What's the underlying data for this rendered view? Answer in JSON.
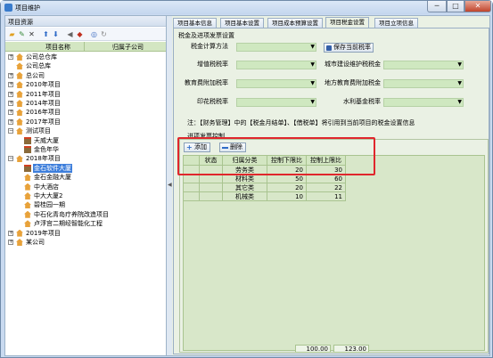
{
  "window": {
    "title": "项目维护",
    "min": "─",
    "max": "□",
    "close": "✕"
  },
  "left": {
    "title": "项目资源",
    "tree_header": {
      "col1": "项目名称",
      "col2": "归属子公司"
    },
    "nodes": [
      {
        "label": "公司总仓库",
        "expander": "+",
        "icon": "house"
      },
      {
        "label": "公司总库",
        "expander": "",
        "icon": "house"
      },
      {
        "label": "总公司",
        "expander": "+",
        "icon": "house"
      },
      {
        "label": "2010年项目",
        "expander": "+",
        "icon": "house"
      },
      {
        "label": "2011年项目",
        "expander": "+",
        "icon": "house"
      },
      {
        "label": "2014年项目",
        "expander": "+",
        "icon": "house"
      },
      {
        "label": "2016年项目",
        "expander": "+",
        "icon": "house"
      },
      {
        "label": "2017年项目",
        "expander": "+",
        "icon": "house"
      },
      {
        "label": "测试项目",
        "expander": "−",
        "icon": "house"
      },
      {
        "label": "天威大厦",
        "expander": "",
        "icon": "bldg"
      },
      {
        "label": "金色年华",
        "expander": "",
        "icon": "bldg"
      },
      {
        "label": "2018年项目",
        "expander": "−",
        "icon": "house"
      },
      {
        "label": "金石软件大厦",
        "expander": "",
        "icon": "bldg",
        "selected": true
      },
      {
        "label": "金石金融大厦",
        "expander": "",
        "icon": "house"
      },
      {
        "label": "中大酒店",
        "expander": "",
        "icon": "house"
      },
      {
        "label": "中大大厦2",
        "expander": "",
        "icon": "house"
      },
      {
        "label": "碧桂园一期",
        "expander": "",
        "icon": "house"
      },
      {
        "label": "中石化青岛疗养院改造项目",
        "expander": "",
        "icon": "house"
      },
      {
        "label": "卢浮宫二期经智能化工程",
        "expander": "",
        "icon": "house"
      },
      {
        "label": "2019年项目",
        "expander": "+",
        "icon": "house"
      },
      {
        "label": "某公司",
        "expander": "+",
        "icon": "house"
      }
    ]
  },
  "tabs": [
    "项目基本信息",
    "项目基本设置",
    "项目成本预算设置",
    "项目税金设置",
    "项目立项信息"
  ],
  "tax": {
    "section_title": "税金及进项发票设置",
    "method_label": "税金计算方法",
    "save_label": "保存当前税率",
    "fields": [
      {
        "label": "增值税税率",
        "right_label": "城市建设维护税税金"
      },
      {
        "label": "教育费附加税率",
        "right_label": "地方教育费附加税金"
      },
      {
        "label": "印花税税率",
        "right_label": "水利基金税率"
      }
    ],
    "note": "注：【财务管理】中的【税金月结单】、【借税单】将引用到当前项目的税金设置信息",
    "invoice_title": "进项发票控制",
    "add_label": "添加",
    "delete_label": "删除"
  },
  "grid": {
    "headers": [
      "状态",
      "归属分类",
      "控制下限比例%",
      "控制上限比例%"
    ],
    "rows": [
      {
        "status": "",
        "category": "劳务类",
        "lower": "20",
        "upper": "30"
      },
      {
        "status": "",
        "category": "材料类",
        "lower": "50",
        "upper": "60"
      },
      {
        "status": "",
        "category": "其它类",
        "lower": "20",
        "upper": "22"
      },
      {
        "status": "",
        "category": "机械类",
        "lower": "10",
        "upper": "11"
      }
    ],
    "total_lower": "100.00",
    "total_upper": "123.00"
  },
  "colors": {
    "highlight": "#e0262c",
    "selection": "#3d7edb",
    "accent_green": "#cfe8c0"
  }
}
